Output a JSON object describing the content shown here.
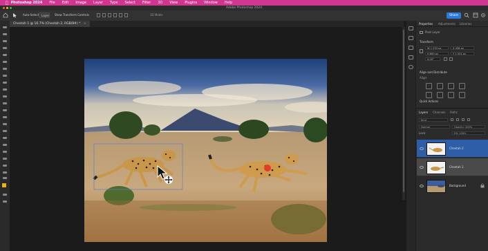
{
  "menubar": {
    "app_name": "Photoshop 2024",
    "items": [
      "File",
      "Edit",
      "Image",
      "Layer",
      "Type",
      "Select",
      "Filter",
      "3D",
      "View",
      "Plugins",
      "Window",
      "Help"
    ]
  },
  "window": {
    "title": "Adobe Photoshop 2024"
  },
  "options_bar": {
    "auto_select_label": "Auto-Select:",
    "layer_dropdown": "Layer",
    "transform_controls_label": "Show Transform Controls",
    "mode_3d_label": "3D Mode:",
    "share_label": "Share"
  },
  "document_tab": {
    "label": "Cheetah 1 @ 16.7% (Cheetah 2, RGB/8#) *"
  },
  "panel": {
    "tabs": [
      "Properties",
      "Adjustments",
      "Libraries"
    ],
    "header_label": "Pixel Layer",
    "transform": {
      "label": "Transform",
      "w": "W 1,233 px",
      "h": "H 800 px",
      "x": "X 458 px",
      "y": "Y 1,024 px",
      "angle": "0.00°"
    },
    "align_label": "Align and Distribute",
    "align_sub": "Align:",
    "quick_actions_label": "Quick Actions",
    "layers_tabs": [
      "Layers",
      "Channels",
      "Paths"
    ],
    "kind_label": "Kind",
    "blend_mode": "Normal",
    "opacity": "Opacity: 100%",
    "lock_label": "Lock:",
    "fill": "Fill: 100%",
    "layers": [
      {
        "name": "Cheetah 2",
        "selected": true
      },
      {
        "name": "Cheetah 1",
        "selected": false
      },
      {
        "name": "Background",
        "selected": false
      }
    ]
  },
  "colors": {
    "menubar": "#d0368f",
    "accent": "#2b7ae0",
    "foreground_swatch": "#f0b400",
    "background_swatch": "#ffffff"
  }
}
